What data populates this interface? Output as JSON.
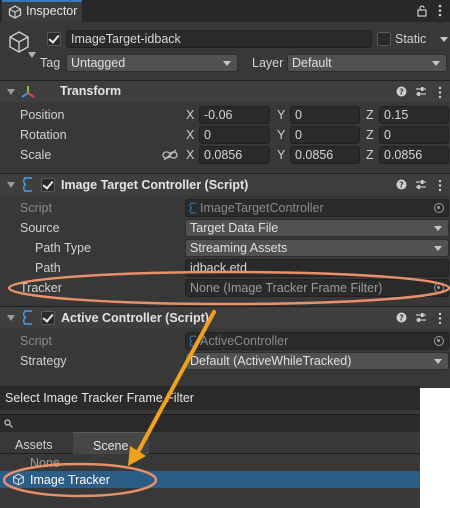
{
  "inspector": {
    "tab_title": "Inspector",
    "object": {
      "active": true,
      "name": "ImageTarget-idback",
      "static_label": "Static",
      "tag_label": "Tag",
      "tag_value": "Untagged",
      "layer_label": "Layer",
      "layer_value": "Default"
    },
    "transform": {
      "title": "Transform",
      "position_label": "Position",
      "rotation_label": "Rotation",
      "scale_label": "Scale",
      "position": {
        "x": "-0.06",
        "y": "0",
        "z": "0.15"
      },
      "rotation": {
        "x": "0",
        "y": "0",
        "z": "0"
      },
      "scale": {
        "x": "0.0856",
        "y": "0.0856",
        "z": "0.0856"
      },
      "axis_x": "X",
      "axis_y": "Y",
      "axis_z": "Z"
    },
    "image_target_controller": {
      "title": "Image Target Controller (Script)",
      "enabled": true,
      "script_label": "Script",
      "script_value": "ImageTargetController",
      "source_label": "Source",
      "source_value": "Target Data File",
      "path_type_label": "Path Type",
      "path_type_value": "Streaming Assets",
      "path_label": "Path",
      "path_value": "idback.etd",
      "tracker_label": "Tracker",
      "tracker_value": "None (Image Tracker Frame Filter)"
    },
    "active_controller": {
      "title": "Active Controller (Script)",
      "enabled": true,
      "script_label": "Script",
      "script_value": "ActiveController",
      "strategy_label": "Strategy",
      "strategy_value": "Default (ActiveWhileTracked)"
    }
  },
  "selector": {
    "title": "Select Image Tracker Frame Filter",
    "tabs": [
      "Assets",
      "Scene"
    ],
    "active_tab": "Scene",
    "items": [
      "None",
      "Image Tracker"
    ],
    "selected_item": "Image Tracker"
  },
  "colors": {
    "panel_bg": "#383838",
    "field_bg": "#2a2a2a",
    "selection": "#2c5d87",
    "annotation": "#e8906a",
    "arrow": "#f2a11c",
    "script_icon": "#4a9be0"
  },
  "icons": [
    "unity-icon",
    "gameobject-cube-icon",
    "lock-icon",
    "menu-dots-icon",
    "transform-axes-icon",
    "help-icon",
    "preset-sliders-icon",
    "script-file-icon",
    "constrain-link-icon",
    "object-picker-icon",
    "search-icon",
    "prefab-cube-icon"
  ]
}
